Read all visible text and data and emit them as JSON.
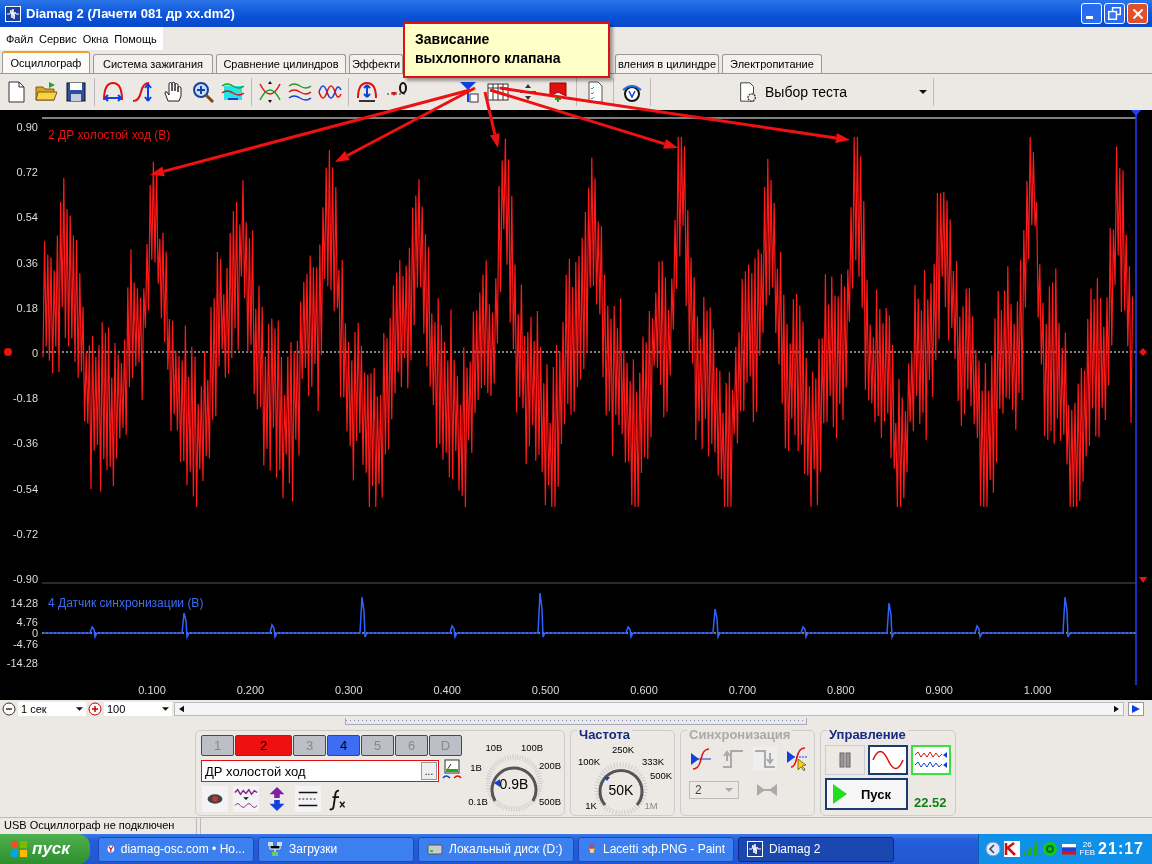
{
  "window": {
    "title": "Diamag 2 (Лачети 081 др xx.dm2)"
  },
  "menu": [
    "Файл",
    "Сервис",
    "Окна",
    "Помощь"
  ],
  "tabs": [
    {
      "label": "Осциллограф",
      "selected": true
    },
    {
      "label": "Система зажигания",
      "selected": false
    },
    {
      "label": "Сравнение цилиндров",
      "selected": false
    },
    {
      "label": "Эффекти",
      "selected": false
    },
    {
      "label": "вления в цилиндре",
      "selected": false
    },
    {
      "label": "Электропитание",
      "selected": false
    }
  ],
  "test_select": {
    "value": "Выбор теста"
  },
  "callout": "Зависание\nвыхлопного клапана",
  "scope": {
    "upper_plot": {
      "label": "2 ДР холостой ход (В)",
      "yticks": [
        "0.90",
        "0.72",
        "0.54",
        "0.36",
        "0.18",
        "0",
        "-0.18",
        "-0.36",
        "-0.54",
        "-0.72",
        "-0.90"
      ]
    },
    "lower_plot": {
      "label": "4 Датчик синхронизации (В)",
      "yticks": [
        "14.28",
        "4.76",
        "0",
        "-4.76",
        "-14.28"
      ]
    },
    "xticks": [
      "0.100",
      "0.200",
      "0.300",
      "0.400",
      "0.500",
      "0.600",
      "0.700",
      "0.800",
      "0.900",
      "1.000"
    ]
  },
  "timebase": {
    "value": "1 сек"
  },
  "samples": {
    "value": "100"
  },
  "channels": [
    {
      "label": "1",
      "on": false
    },
    {
      "label": "2",
      "on": true,
      "color": "#ee1111"
    },
    {
      "label": "3",
      "on": false
    },
    {
      "label": "4",
      "on": true,
      "color": "#3d6df2"
    },
    {
      "label": "5",
      "on": false
    },
    {
      "label": "6",
      "on": false
    },
    {
      "label": "D",
      "on": false
    }
  ],
  "channel_name": {
    "value": "ДР холостой ход",
    "browse": "..."
  },
  "voltage": {
    "value": "0.9В",
    "scale": [
      {
        "label": "0.1В"
      },
      {
        "label": "1В"
      },
      {
        "label": "10В"
      },
      {
        "label": "100В"
      },
      {
        "label": "200В"
      },
      {
        "label": "500В"
      }
    ]
  },
  "frequency": {
    "title": "Частота",
    "value": "50K",
    "scale": [
      {
        "label": "1K",
        "disabled": false
      },
      {
        "label": "100K",
        "disabled": false
      },
      {
        "label": "250K",
        "disabled": false
      },
      {
        "label": "333K",
        "disabled": false
      },
      {
        "label": "500K",
        "disabled": false
      },
      {
        "label": "1M",
        "disabled": true
      }
    ]
  },
  "sync": {
    "title": "Синхронизация",
    "disabled": true,
    "source": "2"
  },
  "control": {
    "title": "Управление",
    "start_label": "Пуск",
    "reading": "22.52",
    "modes": [
      {
        "kind": "pause",
        "selected": false
      },
      {
        "kind": "sine",
        "selected": true
      },
      {
        "kind": "multi",
        "selected": true
      }
    ]
  },
  "status_bar": "USB Осциллограф не подключен",
  "taskbar": {
    "start": "пуск",
    "items": [
      {
        "kind": "browser",
        "label": "diamag-osc.com • Но...",
        "selected": false
      },
      {
        "kind": "network",
        "label": "Загрузки",
        "selected": false
      },
      {
        "kind": "drive",
        "label": "Локальный диск (D:)",
        "selected": false
      },
      {
        "kind": "paint",
        "label": "Lacetti эф.PNG - Paint",
        "selected": false
      },
      {
        "kind": "app",
        "label": "Diamag 2",
        "selected": true
      }
    ],
    "day": "26",
    "month": "FEB",
    "time": "21:17"
  }
}
